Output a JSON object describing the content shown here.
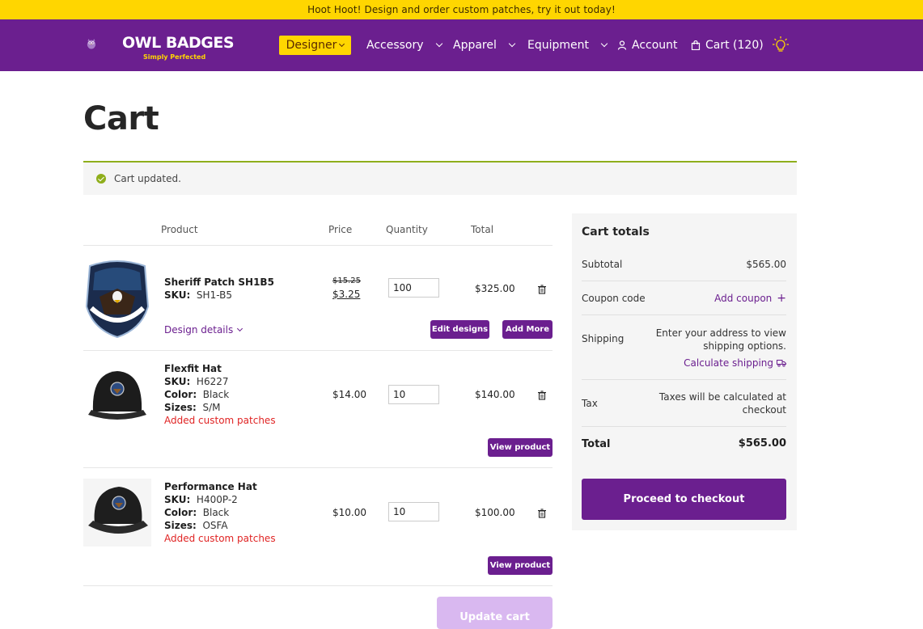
{
  "announcement": "Hoot Hoot! Design and order custom patches, try it out today!",
  "brand": {
    "name": "OWL BADGES",
    "tagline": "Simply Perfected",
    "accent": "#6b1f8f",
    "highlight": "#ffd600"
  },
  "nav": {
    "designer": "Designer",
    "accessory": "Accessory",
    "apparel": "Apparel",
    "equipment": "Equipment",
    "account": "Account",
    "cart": "Cart (120)"
  },
  "page": {
    "title": "Cart",
    "notice": "Cart updated."
  },
  "table": {
    "headers": {
      "product": "Product",
      "price": "Price",
      "quantity": "Quantity",
      "total": "Total"
    }
  },
  "items": [
    {
      "name": "Sheriff Patch SH1B5",
      "sku_label": "SKU:",
      "sku": "SH1-B5",
      "old_price": "$15.25",
      "price": "$3.25",
      "quantity": "100",
      "total": "$325.00",
      "design_details": "Design details",
      "edit_label": "Edit designs",
      "add_label": "Add More"
    },
    {
      "name": "Flexfit Hat",
      "sku_label": "SKU:",
      "sku": "H6227",
      "color_label": "Color:",
      "color": "Black",
      "sizes_label": "Sizes:",
      "sizes": "S/M",
      "note": "Added custom patches",
      "price": "$14.00",
      "quantity": "10",
      "total": "$140.00",
      "view_label": "View product"
    },
    {
      "name": "Performance Hat",
      "sku_label": "SKU:",
      "sku": "H400P-2",
      "color_label": "Color:",
      "color": "Black",
      "sizes_label": "Sizes:",
      "sizes": "OSFA",
      "note": "Added custom patches",
      "price": "$10.00",
      "quantity": "10",
      "total": "$100.00",
      "view_label": "View product"
    }
  ],
  "update_cart": "Update cart",
  "totals": {
    "title": "Cart totals",
    "subtotal_label": "Subtotal",
    "subtotal": "$565.00",
    "coupon_label": "Coupon code",
    "coupon_action": "Add coupon",
    "shipping_label": "Shipping",
    "shipping_line1": "Enter your address to view",
    "shipping_line2": "shipping options.",
    "calc_shipping": "Calculate shipping",
    "tax_label": "Tax",
    "tax_line1": "Taxes will be calculated at",
    "tax_line2": "checkout",
    "total_label": "Total",
    "total": "$565.00",
    "checkout": "Proceed to checkout"
  }
}
